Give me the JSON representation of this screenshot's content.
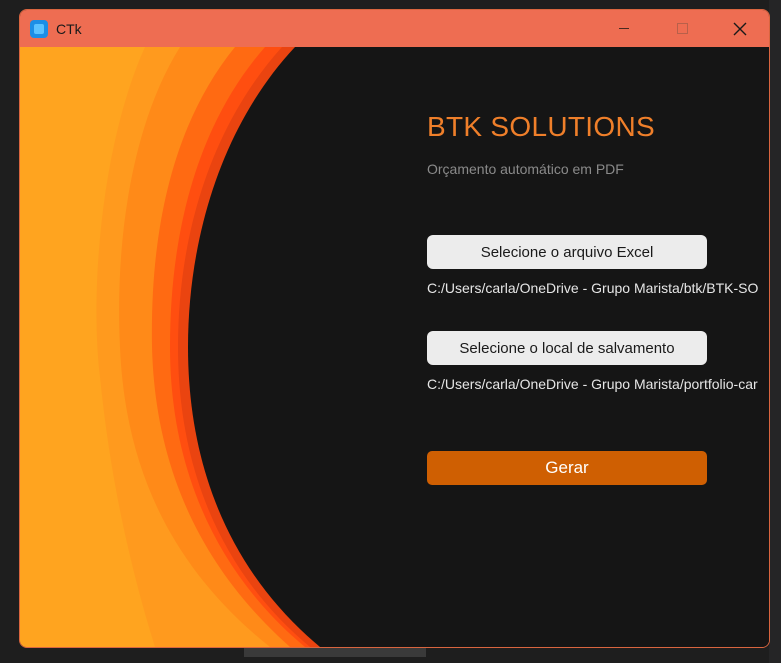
{
  "window": {
    "title": "CTk"
  },
  "header": {
    "title": "BTK SOLUTIONS",
    "subtitle": "Orçamento automático em PDF"
  },
  "excel": {
    "button_label": "Selecione o arquivo Excel",
    "path": "C:/Users/carla/OneDrive - Grupo Marista/btk/BTK-SO"
  },
  "save": {
    "button_label": "Selecione o local de salvamento",
    "path": "C:/Users/carla/OneDrive - Grupo Marista/portfolio-car"
  },
  "generate": {
    "button_label": "Gerar"
  },
  "colors": {
    "titlebar": "#ee6d52",
    "accent_title": "#ef7f2a",
    "generate_button": "#cf5f02",
    "background": "#151515"
  },
  "icons": {
    "app": "ctk-app-icon",
    "minimize": "minimize-icon",
    "maximize": "maximize-icon",
    "close": "close-icon"
  }
}
